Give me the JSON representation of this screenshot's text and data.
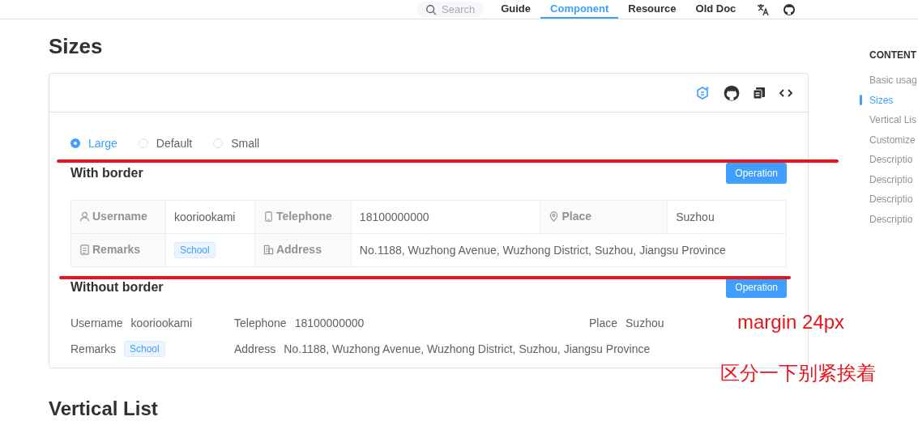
{
  "header": {
    "search_placeholder": "Search",
    "nav": [
      {
        "label": "Guide",
        "selected": false
      },
      {
        "label": "Component",
        "selected": true
      },
      {
        "label": "Resource",
        "selected": false
      },
      {
        "label": "Old Doc",
        "selected": false
      }
    ]
  },
  "page_title": "Sizes",
  "demo": {
    "size_options": [
      {
        "label": "Large",
        "selected": true
      },
      {
        "label": "Default",
        "selected": false
      },
      {
        "label": "Small",
        "selected": false
      }
    ],
    "bordered": {
      "title": "With border",
      "action": "Operation",
      "items": [
        {
          "label": "Username",
          "value": "kooriookami",
          "kind": "text"
        },
        {
          "label": "Telephone",
          "value": "18100000000",
          "kind": "text"
        },
        {
          "label": "Place",
          "value": "Suzhou",
          "kind": "text"
        },
        {
          "label": "Remarks",
          "value": "School",
          "kind": "tag"
        },
        {
          "label": "Address",
          "value": "No.1188, Wuzhong Avenue, Wuzhong District, Suzhou, Jiangsu Province",
          "kind": "text"
        }
      ]
    },
    "plain": {
      "title": "Without border",
      "action": "Operation",
      "items": [
        {
          "label": "Username",
          "value": "kooriookami",
          "kind": "text"
        },
        {
          "label": "Telephone",
          "value": "18100000000",
          "kind": "text"
        },
        {
          "label": "Place",
          "value": "Suzhou",
          "kind": "text"
        },
        {
          "label": "Remarks",
          "value": "School",
          "kind": "tag"
        },
        {
          "label": "Address",
          "value": "No.1188, Wuzhong Avenue, Wuzhong District, Suzhou, Jiangsu Province",
          "kind": "text"
        }
      ]
    }
  },
  "annotations": [
    {
      "text": "margin 24px"
    },
    {
      "text": "区分一下别紧挨着"
    }
  ],
  "next_heading": "Vertical List",
  "toc": {
    "title": "CONTENT",
    "items": [
      {
        "label": "Basic usag",
        "selected": false
      },
      {
        "label": "Sizes",
        "selected": true
      },
      {
        "label": "Vertical Lis",
        "selected": false
      },
      {
        "label": "Customize",
        "selected": false
      },
      {
        "label": "Descriptio",
        "selected": false
      },
      {
        "label": "Descriptio",
        "selected": false
      },
      {
        "label": "Descriptio",
        "selected": false
      },
      {
        "label": "Descriptio",
        "selected": false
      }
    ]
  }
}
